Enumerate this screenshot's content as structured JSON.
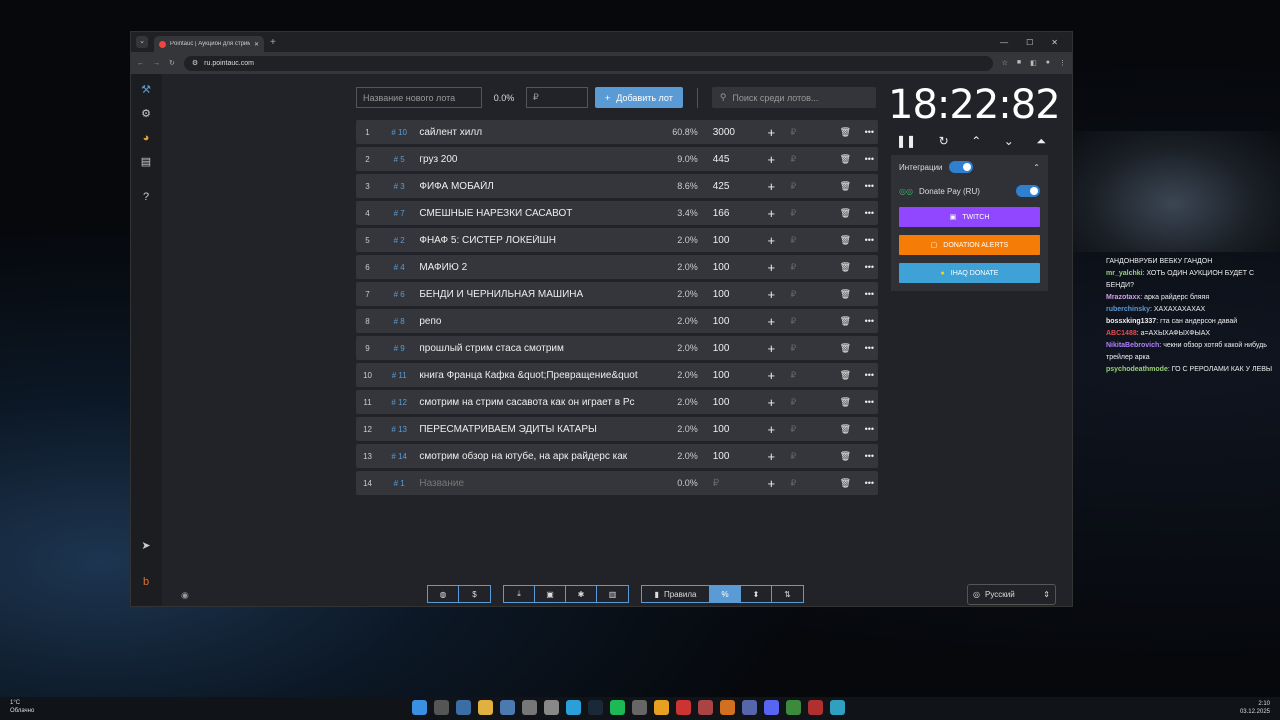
{
  "browser": {
    "tab_title": "Pointauc | Аукцион для стрим...",
    "url": "ru.pointauc.com"
  },
  "controls": {
    "name_placeholder": "Название нового лота",
    "percent": "0.0%",
    "amount_placeholder": "₽",
    "add_label": "Добавить лот",
    "search_placeholder": "Поиск среди лотов..."
  },
  "lots": [
    {
      "num": "1",
      "id": "# 10",
      "name": "сайлент хилл",
      "percent": "60.8%",
      "amount": "3000"
    },
    {
      "num": "2",
      "id": "# 5",
      "name": "груз 200",
      "percent": "9.0%",
      "amount": "445"
    },
    {
      "num": "3",
      "id": "# 3",
      "name": "ФИФА МОБАЙЛ",
      "percent": "8.6%",
      "amount": "425"
    },
    {
      "num": "4",
      "id": "# 7",
      "name": "СМЕШНЫЕ НАРЕЗКИ САСАВОТ",
      "percent": "3.4%",
      "amount": "166"
    },
    {
      "num": "5",
      "id": "# 2",
      "name": "ФНАФ 5: СИСТЕР ЛОКЕЙШН",
      "percent": "2.0%",
      "amount": "100"
    },
    {
      "num": "6",
      "id": "# 4",
      "name": "МАФИЮ 2",
      "percent": "2.0%",
      "amount": "100"
    },
    {
      "num": "7",
      "id": "# 6",
      "name": "БЕНДИ И ЧЕРНИЛЬНАЯ МАШИНА",
      "percent": "2.0%",
      "amount": "100"
    },
    {
      "num": "8",
      "id": "# 8",
      "name": "репо",
      "percent": "2.0%",
      "amount": "100"
    },
    {
      "num": "9",
      "id": "# 9",
      "name": "прошлый стрим стаса смотрим",
      "percent": "2.0%",
      "amount": "100"
    },
    {
      "num": "10",
      "id": "# 11",
      "name": "книга Франца Кафка &quot;Превращение&quot",
      "percent": "2.0%",
      "amount": "100"
    },
    {
      "num": "11",
      "id": "# 12",
      "name": "смотрим на стрим сасавота как он играет в Рс",
      "percent": "2.0%",
      "amount": "100"
    },
    {
      "num": "12",
      "id": "# 13",
      "name": "ПЕРЕСМАТРИВАЕМ ЭДИТЫ КАТАРЫ",
      "percent": "2.0%",
      "amount": "100"
    },
    {
      "num": "13",
      "id": "# 14",
      "name": "смотрим обзор  на ютубе, на арк райдерс как",
      "percent": "2.0%",
      "amount": "100"
    },
    {
      "num": "14",
      "id": "# 1",
      "name": "Название",
      "percent": "0.0%",
      "amount": "₽",
      "placeholder": true
    }
  ],
  "timer": "18:22:82",
  "integrations": {
    "title": "Интеграции",
    "donatepay": "Donate Pay (RU)",
    "twitch": "TWITCH",
    "donation_alerts": "DONATION ALERTS",
    "ihaq": "IHAQ DONATE"
  },
  "bottom": {
    "rules": "Правила",
    "percent_symbol": "%"
  },
  "language": "Русский",
  "chat": [
    {
      "user": "",
      "text": "ГАНДОНВРУБИ ВЕБКУ ГАНДОН",
      "color": "#eeeeee"
    },
    {
      "user": "mr_yalchki",
      "text": "ХОТЬ ОДИН АУКЦИОН БУДЕТ С БЕНДИ?",
      "color": "#9ad07a"
    },
    {
      "user": "Mrazotaxx",
      "text": "арка райдерс бляяя",
      "color": "#d0a0e0"
    },
    {
      "user": "ruberchinsky",
      "text": "ХАХАХАХАХАХ",
      "color": "#5b9bd5"
    },
    {
      "user": "bossxking1337",
      "text": "гта сан андерсон давай",
      "color": "#eeeeee"
    },
    {
      "user": "ABC1488",
      "text": "а=АХЫХАФЫХФЫАХ",
      "color": "#e05050"
    },
    {
      "user": "NikitaBebrovich",
      "text": "чекни обзор хотяб какой нибудь трейлер арка",
      "color": "#b080ff"
    },
    {
      "user": "psychodeathmode",
      "text": "ГО С РЕРОЛАМИ КАК У ЛЕВЫ",
      "color": "#9ad07a"
    }
  ],
  "taskbar": {
    "weather_temp": "1°C",
    "weather_desc": "Облачно",
    "time": "2:10",
    "date": "03.12.2025"
  },
  "colors": {
    "accent": "#5b9bd5",
    "twitch": "#9146ff",
    "donation_alerts": "#f57d07",
    "ihaq": "#3fa2d6"
  }
}
